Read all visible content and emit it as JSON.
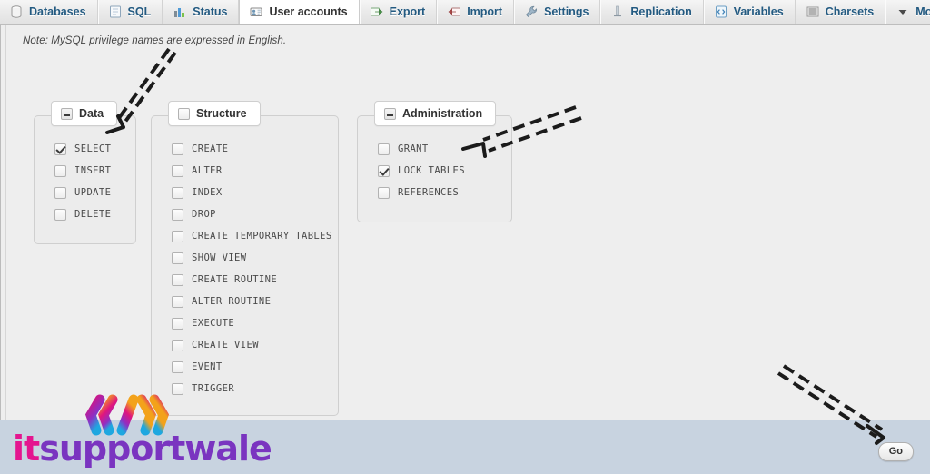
{
  "nav": {
    "tabs": [
      {
        "label": "Databases",
        "icon": "database-icon",
        "active": false
      },
      {
        "label": "SQL",
        "icon": "sql-icon",
        "active": false
      },
      {
        "label": "Status",
        "icon": "status-chart-icon",
        "active": false
      },
      {
        "label": "User accounts",
        "icon": "user-accounts-icon",
        "active": true
      },
      {
        "label": "Export",
        "icon": "export-icon",
        "active": false
      },
      {
        "label": "Import",
        "icon": "import-icon",
        "active": false
      },
      {
        "label": "Settings",
        "icon": "wrench-icon",
        "active": false
      },
      {
        "label": "Replication",
        "icon": "replication-icon",
        "active": false
      },
      {
        "label": "Variables",
        "icon": "variables-icon",
        "active": false
      },
      {
        "label": "Charsets",
        "icon": "charsets-icon",
        "active": false
      },
      {
        "label": "More",
        "icon": "chevron-down-icon",
        "active": false
      }
    ]
  },
  "main": {
    "note": "Note: MySQL privilege names are expressed in English.",
    "groups": [
      {
        "id": "data",
        "legend": "Data",
        "legend_state": "indeterminate",
        "items": [
          {
            "label": "SELECT",
            "checked": true
          },
          {
            "label": "INSERT",
            "checked": false
          },
          {
            "label": "UPDATE",
            "checked": false
          },
          {
            "label": "DELETE",
            "checked": false
          }
        ]
      },
      {
        "id": "structure",
        "legend": "Structure",
        "legend_state": "unchecked",
        "items": [
          {
            "label": "CREATE",
            "checked": false
          },
          {
            "label": "ALTER",
            "checked": false
          },
          {
            "label": "INDEX",
            "checked": false
          },
          {
            "label": "DROP",
            "checked": false
          },
          {
            "label": "CREATE TEMPORARY TABLES",
            "checked": false
          },
          {
            "label": "SHOW VIEW",
            "checked": false
          },
          {
            "label": "CREATE ROUTINE",
            "checked": false
          },
          {
            "label": "ALTER ROUTINE",
            "checked": false
          },
          {
            "label": "EXECUTE",
            "checked": false
          },
          {
            "label": "CREATE VIEW",
            "checked": false
          },
          {
            "label": "EVENT",
            "checked": false
          },
          {
            "label": "TRIGGER",
            "checked": false
          }
        ]
      },
      {
        "id": "administration",
        "legend": "Administration",
        "legend_state": "indeterminate",
        "items": [
          {
            "label": "GRANT",
            "checked": false
          },
          {
            "label": "LOCK TABLES",
            "checked": true
          },
          {
            "label": "REFERENCES",
            "checked": false
          }
        ]
      }
    ]
  },
  "footer": {
    "go_label": "Go"
  },
  "watermark": {
    "text_primary": "it",
    "text_secondary": "supportwale",
    "icon": "code-brackets-icon",
    "color_primary": "#e4158f",
    "color_secondary": "#7a34c0"
  },
  "annotations": [
    {
      "name": "arrow-to-select-checkbox",
      "style": "dashed-arrow"
    },
    {
      "name": "arrow-to-lock-tables",
      "style": "dashed-arrow"
    },
    {
      "name": "arrow-to-go-button",
      "style": "dashed-arrow"
    }
  ],
  "colors": {
    "nav_link": "#235a81",
    "panel_bg": "#eeeeee",
    "bottom_bar": "#c8d3e0"
  }
}
